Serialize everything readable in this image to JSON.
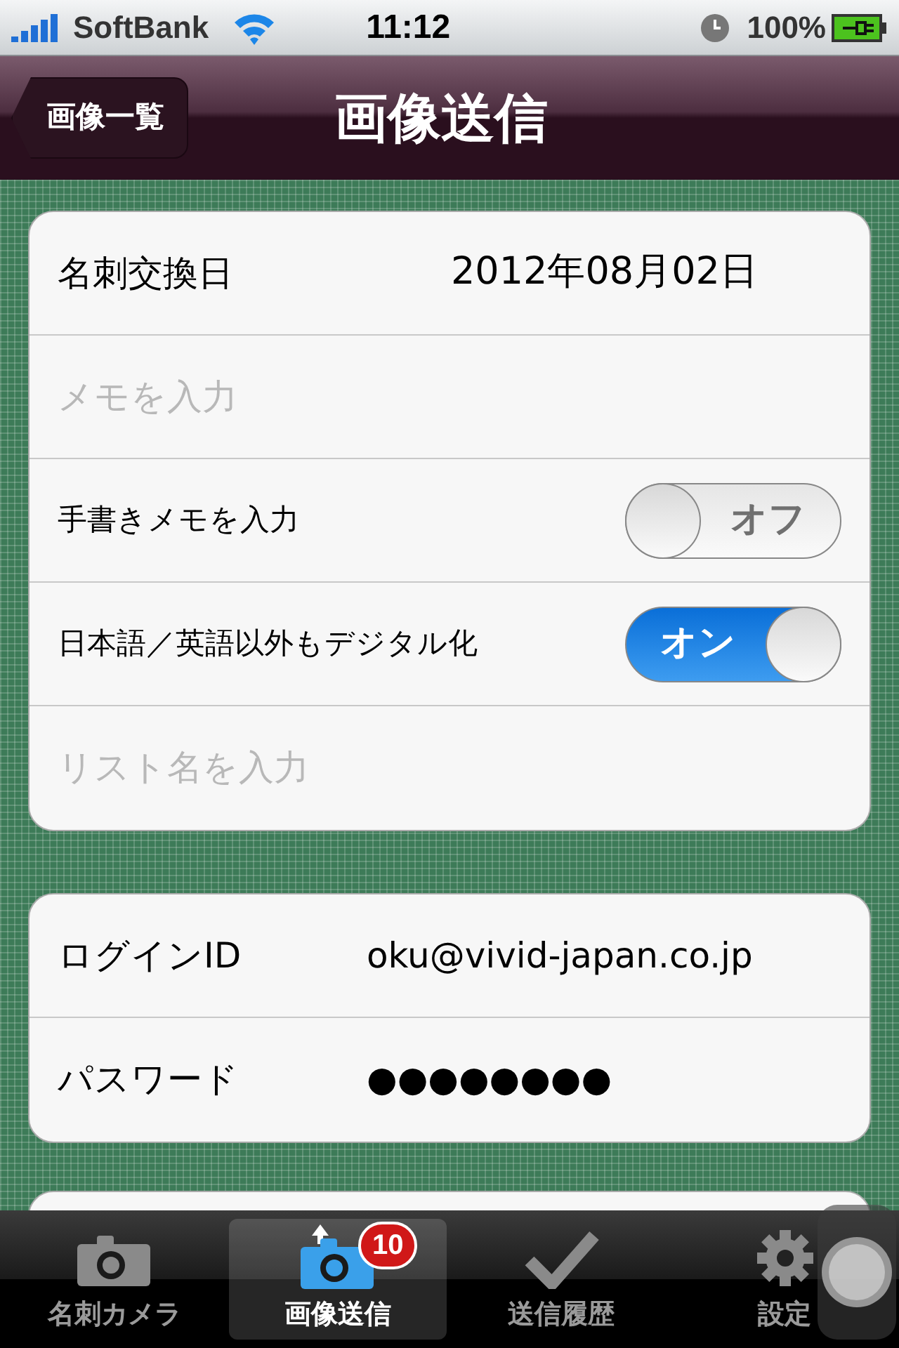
{
  "status_bar": {
    "carrier": "SoftBank",
    "time": "11:12",
    "battery": "100%"
  },
  "nav": {
    "back": "画像一覧",
    "title": "画像送信"
  },
  "groups": [
    {
      "rows": [
        {
          "kind": "value",
          "label": "名刺交換日",
          "value": "2012年08月02日"
        },
        {
          "kind": "input",
          "placeholder": "メモを入力"
        },
        {
          "kind": "switch",
          "label": "手書きメモを入力",
          "on": false,
          "state": "オフ"
        },
        {
          "kind": "switch",
          "label": "日本語／英語以外もデジタル化",
          "on": true,
          "state": "オン"
        },
        {
          "kind": "input",
          "placeholder": "リスト名を入力"
        }
      ]
    },
    {
      "rows": [
        {
          "kind": "value",
          "label": "ログインID",
          "value": "oku@vivid-japan.co.jp"
        },
        {
          "kind": "value",
          "label": "パスワード",
          "value": "●●●●●●●●"
        }
      ]
    }
  ],
  "tabs": [
    {
      "label": "名刺カメラ",
      "selected": false
    },
    {
      "label": "画像送信",
      "selected": true,
      "badge": "10"
    },
    {
      "label": "送信履歴",
      "selected": false
    },
    {
      "label": "設定",
      "selected": false
    }
  ]
}
